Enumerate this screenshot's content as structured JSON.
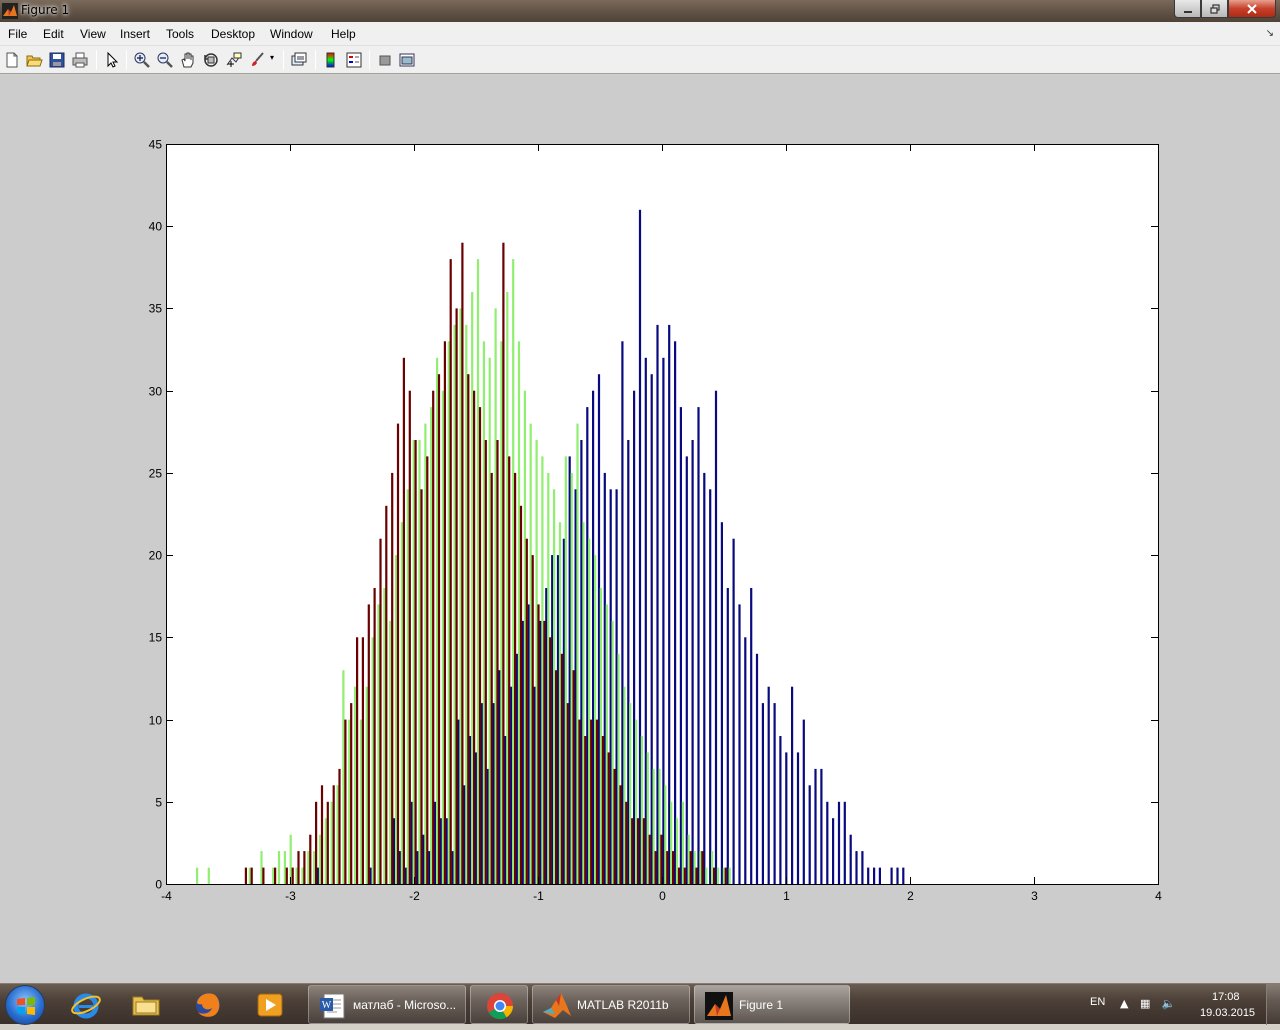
{
  "window": {
    "title": "Figure 1"
  },
  "menu": [
    "File",
    "Edit",
    "View",
    "Insert",
    "Tools",
    "Desktop",
    "Window",
    "Help"
  ],
  "toolbar": {
    "icons": [
      "new-figure-icon",
      "open-file-icon",
      "save-icon",
      "print-icon",
      "edit-plot-icon",
      "zoom-in-icon",
      "zoom-out-icon",
      "pan-icon",
      "rotate-3d-icon",
      "data-cursor-icon",
      "brush-icon",
      "link-plot-icon",
      "insert-colorbar-icon",
      "insert-legend-icon",
      "hide-plot-tools-icon",
      "show-plot-tools-icon"
    ]
  },
  "chart_data": {
    "type": "bar",
    "title": "",
    "xlabel": "",
    "ylabel": "",
    "xlim": [
      -4,
      4
    ],
    "ylim": [
      0,
      45
    ],
    "xticks": [
      "-4",
      "-3",
      "-2",
      "-1",
      "0",
      "1",
      "2",
      "3",
      "4"
    ],
    "yticks": [
      "0",
      "5",
      "10",
      "15",
      "20",
      "25",
      "30",
      "35",
      "40",
      "45"
    ],
    "bin_start": -3.75,
    "bin_width": 0.0472,
    "series_colors": [
      "#0a0a80",
      "#90ee70",
      "#6a0000"
    ],
    "series": [
      {
        "values": [
          0,
          0,
          0,
          0,
          0,
          0,
          0,
          0,
          0,
          0,
          0,
          0,
          0,
          0,
          0,
          0,
          0,
          0,
          0,
          0,
          0,
          1,
          0,
          0,
          0,
          0,
          0,
          0,
          0,
          0,
          1,
          0,
          0,
          0,
          4,
          2,
          1,
          5,
          2,
          3,
          2,
          5,
          4,
          4,
          2,
          10,
          6,
          9,
          8,
          11,
          7,
          11,
          13,
          9,
          12,
          14,
          16,
          17,
          12,
          16,
          18,
          20,
          20,
          21,
          26,
          24,
          27,
          29,
          30,
          31,
          25,
          24,
          24,
          33,
          27,
          30,
          41,
          32,
          31,
          34,
          32,
          34,
          33,
          29,
          26,
          27,
          29,
          25,
          24,
          30,
          22,
          18,
          21,
          17,
          15,
          18,
          14,
          11,
          12,
          11,
          9,
          8,
          12,
          8,
          10,
          6,
          7,
          7,
          5,
          4,
          5,
          5,
          3,
          2,
          2,
          1,
          1,
          1,
          0,
          1,
          1,
          1,
          0,
          0,
          0,
          0,
          0,
          0,
          0,
          0,
          0,
          0,
          0,
          0,
          0,
          0
        ]
      },
      {
        "values": [
          1,
          0,
          1,
          0,
          0,
          0,
          0,
          0,
          0,
          1,
          0,
          2,
          0,
          1,
          2,
          2,
          3,
          1,
          1,
          2,
          2,
          3,
          4,
          5,
          6,
          13,
          10,
          12,
          10,
          12,
          15,
          17,
          18,
          16,
          20,
          22,
          24,
          27,
          27,
          28,
          29,
          32,
          30,
          33,
          34,
          35,
          34,
          36,
          38,
          33,
          32,
          35,
          33,
          36,
          38,
          33,
          30,
          28,
          27,
          26,
          25,
          24,
          22,
          26,
          25,
          28,
          22,
          21,
          20,
          18,
          17,
          16,
          14,
          12,
          11,
          10,
          9,
          8,
          7,
          7,
          6,
          5,
          4,
          5,
          3,
          2,
          2,
          1,
          2,
          1,
          1,
          1,
          0,
          0,
          0,
          0,
          0,
          0,
          0,
          0,
          0,
          0,
          0,
          0,
          0,
          0,
          0,
          0,
          0,
          0,
          0,
          0,
          0,
          0,
          0,
          0,
          0,
          0,
          0,
          0,
          0,
          0,
          0,
          0,
          0,
          0,
          0,
          0,
          0,
          0,
          0,
          0,
          0,
          0,
          0,
          0,
          0,
          0
        ]
      },
      {
        "values": [
          0,
          0,
          0,
          0,
          0,
          0,
          0,
          0,
          1,
          1,
          0,
          1,
          0,
          1,
          0,
          1,
          1,
          2,
          2,
          3,
          5,
          6,
          5,
          6,
          7,
          10,
          11,
          15,
          15,
          17,
          18,
          21,
          23,
          25,
          28,
          32,
          30,
          27,
          24,
          26,
          30,
          31,
          33,
          38,
          35,
          39,
          31,
          30,
          29,
          27,
          25,
          27,
          39,
          26,
          25,
          23,
          21,
          20,
          17,
          16,
          15,
          13,
          14,
          11,
          13,
          10,
          9,
          10,
          10,
          9,
          8,
          7,
          6,
          5,
          4,
          4,
          4,
          3,
          2,
          3,
          2,
          2,
          1,
          1,
          2,
          1,
          2,
          0,
          1,
          0,
          1,
          0,
          0,
          0,
          0,
          0,
          0,
          0,
          0,
          0,
          0,
          0,
          0,
          0,
          0,
          0,
          0,
          0,
          0,
          0,
          0,
          0,
          0,
          0,
          0,
          0,
          0,
          0,
          0,
          0,
          0,
          0,
          0,
          0,
          0,
          0,
          0,
          0,
          0,
          0,
          0,
          0,
          0,
          0,
          0,
          0,
          0,
          0
        ]
      }
    ]
  },
  "taskbar": {
    "pinned": [
      "internet-explorer-icon",
      "file-explorer-icon",
      "firefox-icon",
      "media-player-icon"
    ],
    "tasks": [
      {
        "label": "матлаб - Microso...",
        "icon": "word-icon"
      },
      {
        "label": "",
        "icon": "chrome-icon"
      },
      {
        "label": "MATLAB  R2011b",
        "icon": "matlab-icon"
      },
      {
        "label": "Figure 1",
        "icon": "matlab-figure-icon"
      }
    ],
    "tray": {
      "language": "EN",
      "time": "17:08",
      "date": "19.03.2015"
    }
  }
}
